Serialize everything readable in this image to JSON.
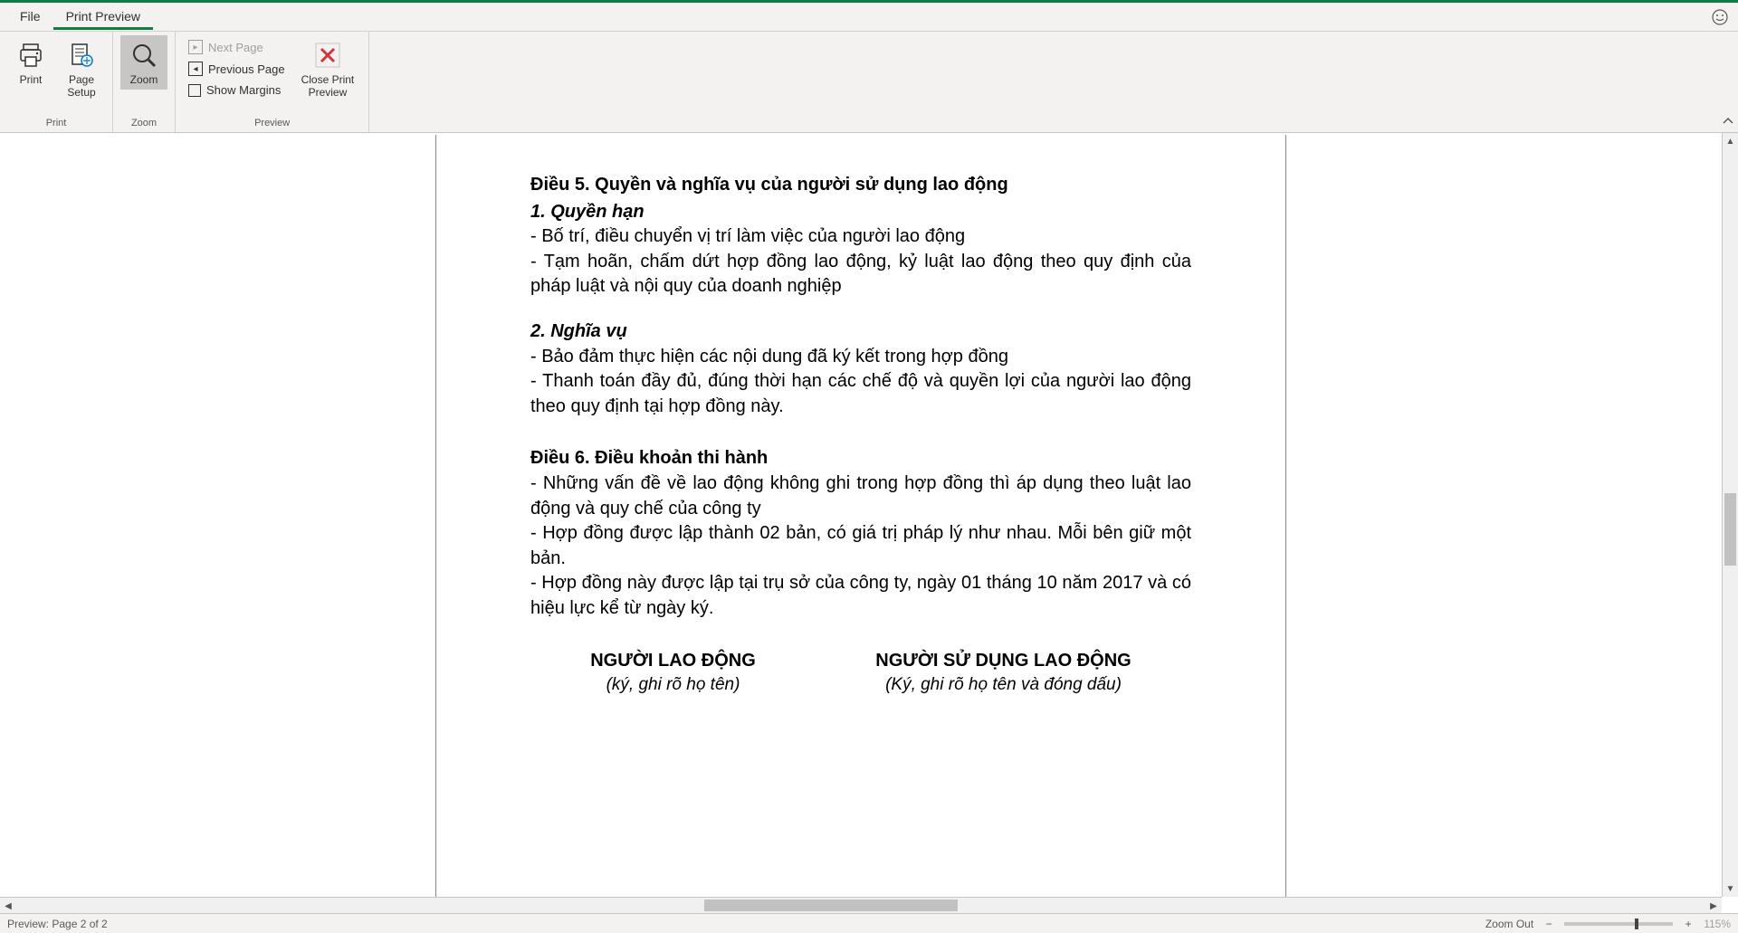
{
  "tabs": {
    "file": "File",
    "printPreview": "Print Preview"
  },
  "ribbon": {
    "print": {
      "groupLabel": "Print",
      "printBtn": "Print",
      "pageSetup1": "Page",
      "pageSetup2": "Setup"
    },
    "zoom": {
      "groupLabel": "Zoom",
      "zoomBtn": "Zoom"
    },
    "preview": {
      "groupLabel": "Preview",
      "nextPage": "Next Page",
      "previousPage": "Previous Page",
      "showMargins": "Show Margins",
      "close1": "Close Print",
      "close2": "Preview"
    }
  },
  "doc": {
    "article5": "Điều 5. Quyền và nghĩa vụ của người sử dụng lao động",
    "sec1": "1. Quyền hạn",
    "sec1_l1": "- Bố trí, điều chuyển vị trí làm việc của người lao động",
    "sec1_l2": "- Tạm hoãn, chấm dứt hợp đồng lao động, kỷ luật lao động theo quy định của pháp luật và nội quy của doanh nghiệp",
    "sec2": "2. Nghĩa vụ",
    "sec2_l1": "- Bảo đảm thực hiện các nội dung đã ký kết trong hợp đồng",
    "sec2_l2": "- Thanh toán đầy đủ, đúng thời hạn các chế độ và quyền lợi của người lao động theo quy định tại hợp đồng này.",
    "article6": "Điều 6. Điều khoản thi hành",
    "a6_l1": "- Những vấn đề về lao động không ghi trong hợp đồng thì áp dụng theo luật lao động và quy chế của công ty",
    "a6_l2": "- Hợp đồng được lập thành 02 bản, có giá trị pháp lý như nhau. Mỗi bên giữ một bản.",
    "a6_l3": "- Hợp đồng này được lập tại trụ sở của công ty, ngày 01 tháng 10 năm 2017 và có hiệu lực kể từ ngày ký.",
    "sig_employee_title": "NGƯỜI LAO ĐỘNG",
    "sig_employee_note": "(ký, ghi rõ họ tên)",
    "sig_employer_title": "NGƯỜI SỬ DỤNG LAO ĐỘNG",
    "sig_employer_note": "(Ký, ghi rõ họ tên và đóng dấu)"
  },
  "status": {
    "left": "Preview: Page 2 of 2",
    "zoomOut": "Zoom Out",
    "zoomPct": "115%"
  }
}
